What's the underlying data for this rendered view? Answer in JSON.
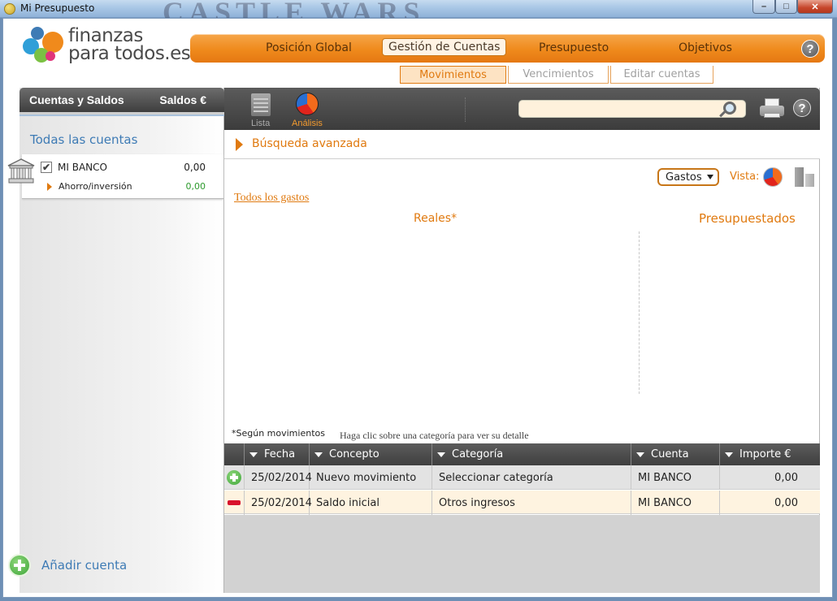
{
  "window": {
    "title": "Mi Presupuesto",
    "background_banner": "CASTLE WARS",
    "min_glyph": "–",
    "max_glyph": "□",
    "close_glyph": "✕"
  },
  "logo": {
    "line1": "finanzas",
    "line2": "para todos.es"
  },
  "main_nav": {
    "items": [
      "Posición Global",
      "Gestión de Cuentas",
      "Presupuesto",
      "Objetivos"
    ],
    "active": "Gestión de Cuentas",
    "help": "?"
  },
  "sub_tabs": {
    "items": [
      "Movimientos",
      "Vencimientos",
      "Editar cuentas"
    ],
    "active": "Movimientos"
  },
  "left_panel": {
    "header_left": "Cuentas y Saldos",
    "header_right": "Saldos €",
    "all_accounts": "Todas las cuentas",
    "account": {
      "checked": "✔",
      "name": "MI BANCO",
      "balance": "0,00",
      "sub_name": "Ahorro/inversión",
      "sub_balance": "0,00"
    },
    "add_account": "Añadir cuenta"
  },
  "toolbar": {
    "lista": "Lista",
    "analisis": "Análisis",
    "help": "?"
  },
  "search": {
    "placeholder": ""
  },
  "advanced_search": "Búsqueda avanzada",
  "analysis": {
    "type_select": "Gastos",
    "vista_label": "Vista:",
    "all_link": "Todos los gastos",
    "reales": "Reales*",
    "presupuestados": "Presupuestados",
    "footnote": "*Según movimientos",
    "hint": "Haga clic sobre una categoría para ver su detalle"
  },
  "table": {
    "columns": [
      "Fecha",
      "Concepto",
      "Categoría",
      "Cuenta",
      "Importe €"
    ],
    "rows": [
      {
        "icon": "plus-icon",
        "fecha": "25/02/2014",
        "concepto": "Nuevo movimiento",
        "categoria": "Seleccionar categoría",
        "cuenta": "MI BANCO",
        "importe": "0,00"
      },
      {
        "icon": "minus-icon",
        "fecha": "25/02/2014",
        "concepto": "Saldo inicial",
        "categoria": "Otros ingresos",
        "cuenta": "MI BANCO",
        "importe": "0,00"
      }
    ]
  },
  "colors": {
    "accent_orange": "#e07a10",
    "link_blue": "#3e7bb5",
    "positive_green": "#2d9a2d"
  }
}
